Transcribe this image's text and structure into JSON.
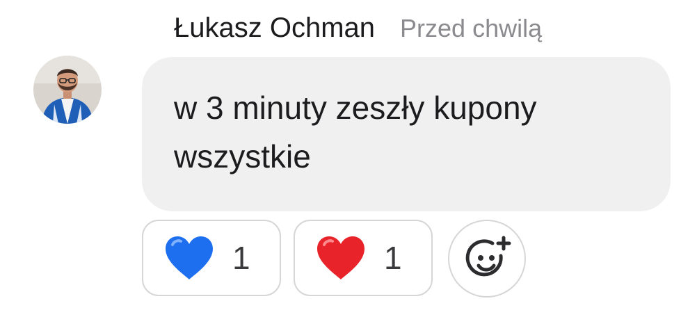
{
  "comment": {
    "author": "Łukasz Ochman",
    "timestamp": "Przed chwilą",
    "avatar_icon": "user-avatar-photo",
    "text_lines": [
      "w 3 minuty zeszły kupony",
      "wszystkie"
    ],
    "bubble_color": "#f0f0f1"
  },
  "reactions": [
    {
      "icon": "blue-heart-icon",
      "color": "#1e6ff0",
      "count": "1"
    },
    {
      "icon": "red-heart-icon",
      "color": "#e8232a",
      "count": "1"
    }
  ],
  "add_reaction": {
    "icon": "add-emoji-icon"
  }
}
